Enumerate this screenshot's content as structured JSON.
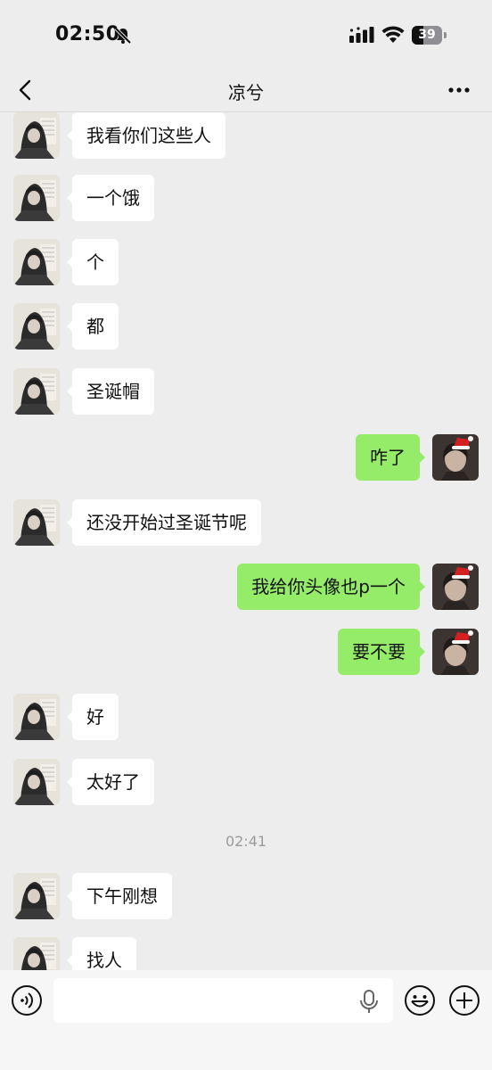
{
  "status_bar": {
    "time": "02:50",
    "battery_level": "39",
    "battery_fraction": 0.39
  },
  "header": {
    "title": "凉兮"
  },
  "messages": [
    {
      "side": "left",
      "text": "我看你们这些人"
    },
    {
      "side": "left",
      "text": "一个饿"
    },
    {
      "side": "left",
      "text": "个"
    },
    {
      "side": "left",
      "text": "都"
    },
    {
      "side": "left",
      "text": "圣诞帽"
    },
    {
      "side": "right",
      "text": "咋了"
    },
    {
      "side": "left",
      "text": "还没开始过圣诞节呢"
    },
    {
      "side": "right",
      "text": "我给你头像也p一个"
    },
    {
      "side": "right",
      "text": "要不要"
    },
    {
      "side": "left",
      "text": "好"
    },
    {
      "side": "left",
      "text": "太好了"
    },
    {
      "side": "left",
      "text": "下午刚想"
    },
    {
      "side": "left",
      "text": "找人"
    }
  ],
  "time_divider": "02:41",
  "input": {
    "value": "",
    "placeholder": ""
  },
  "icons": {
    "back": "chevron-left-icon",
    "more": "more-dots-icon",
    "voice": "voice-icon",
    "mic": "microphone-icon",
    "emoji": "emoji-icon",
    "plus": "plus-icon",
    "bell_off": "bell-off-icon"
  },
  "colors": {
    "background": "#ededed",
    "bubble_self": "#95ec69",
    "bubble_other": "#ffffff",
    "time_text": "#9b9b9b"
  }
}
